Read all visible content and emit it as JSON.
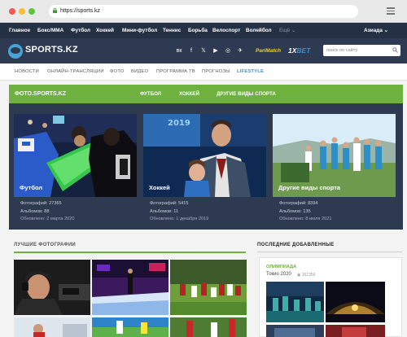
{
  "browser": {
    "url": "https://sports.kz"
  },
  "topnav": {
    "items": [
      "Главное",
      "Бокс/ММА",
      "Футбол",
      "Хоккей",
      "Мини-футбол",
      "Теннис",
      "Борьба",
      "Велоспорт",
      "Волейбол",
      "Ещё"
    ],
    "city": "Азиада"
  },
  "header": {
    "logo": "SPORTS.KZ",
    "social": [
      "вк",
      "f",
      "𝕏",
      "▶",
      "◎",
      "✈"
    ],
    "sponsor1": "PariMatch",
    "sponsor2_prefix": "1X",
    "sponsor2_suffix": "BET",
    "search_placeholder": "поиск по сайту"
  },
  "secnav": {
    "items": [
      "НОВОСТИ",
      "ОНЛАЙН-ТРАНСЛЯЦИИ",
      "ФОТО",
      "ВИДЕО",
      "ПРОГРАММА ТВ",
      "ПРОГНОЗЫ",
      "LIFESTYLE"
    ]
  },
  "photos": {
    "title": "ФОТО.SPORTS.KZ",
    "tabs": [
      "ФУТБОЛ",
      "ХОККЕЙ",
      "ДРУГИЕ ВИДЫ СПОРТА"
    ],
    "cards": [
      {
        "caption": "Футбол",
        "photos": "Фотографий: 27365",
        "albums": "Альбомов: 88",
        "updated": "Обновлено: 2 марта 2020"
      },
      {
        "caption": "Хоккей",
        "photos": "Фотографий: 5415",
        "albums": "Альбомов: 11",
        "updated": "Обновлено: 1 декабря 2019"
      },
      {
        "caption": "Другие виды спорта",
        "photos": "Фотографий: 8394",
        "albums": "Альбомов: 135",
        "updated": "Обновлено: 8 июля 2021"
      }
    ]
  },
  "best": {
    "title": "ЛУЧШИЕ ФОТОГРАФИИ"
  },
  "recent": {
    "title": "ПОСЛЕДНИЕ ДОБАВЛЕННЫЕ",
    "tag": "ОЛИМПИАДА",
    "album": "Токио 2020",
    "count": "161356"
  },
  "colors": {
    "accent_green": "#6fb13e",
    "nav_dark": "#243044",
    "header": "#2d3a52",
    "panel": "#2e3a50",
    "link_blue": "#3a8fd9"
  }
}
